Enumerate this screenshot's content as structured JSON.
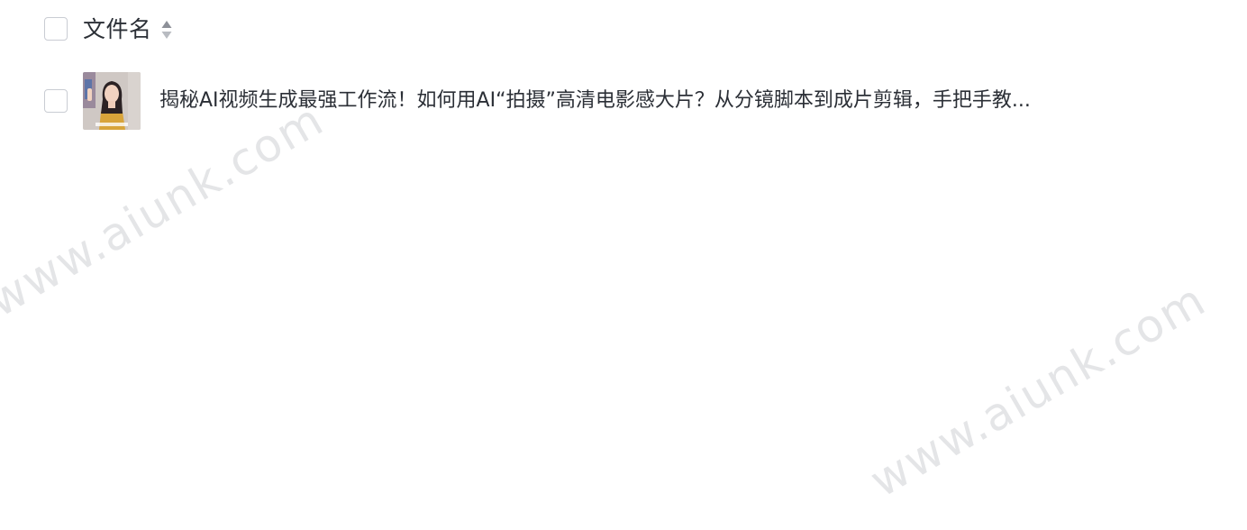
{
  "header": {
    "column_title": "文件名"
  },
  "files": [
    {
      "name": "揭秘AI视频生成最强工作流！如何用AI“拍摄”高清电影感大片？从分镜脚本到成片剪辑，手把手教..."
    }
  ],
  "watermark": "www.aiunk.com",
  "colors": {
    "text": "#2b2f36",
    "checkbox_border": "#c9ccd3",
    "watermark": "#e4e5e7"
  }
}
